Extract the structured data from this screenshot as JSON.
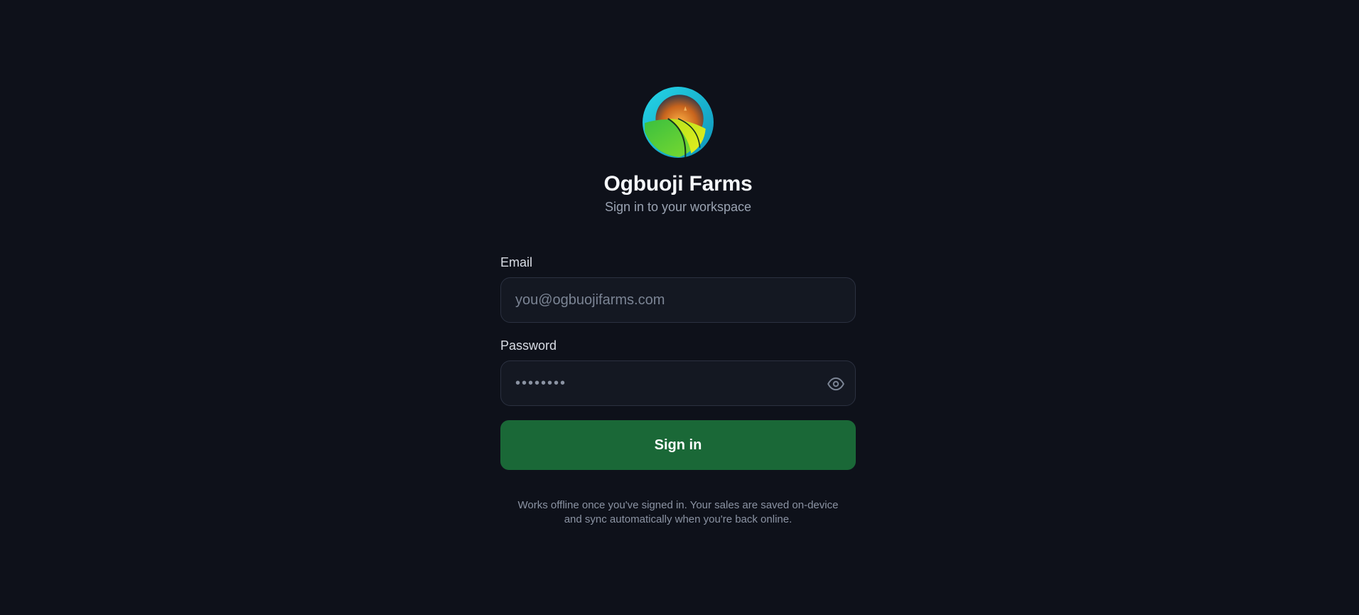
{
  "brand": {
    "name": "Ogbuoji Farms",
    "subtitle": "Sign in to your workspace",
    "logo_icon": "farm-sun-field-logo"
  },
  "form": {
    "email": {
      "label": "Email",
      "placeholder": "you@ogbuojifarms.com",
      "value": ""
    },
    "password": {
      "label": "Password",
      "placeholder": "••••••••",
      "value": "",
      "toggle_icon": "eye-icon"
    },
    "submit_label": "Sign in"
  },
  "footer": {
    "line1": "Works offline once you've signed in. Your sales are saved on-device",
    "line2": "and sync automatically when you're back online."
  },
  "colors": {
    "background": "#0e111a",
    "input_bg": "#141822",
    "input_border": "#2b3140",
    "button": "#1a6837",
    "logo_ring": "#19bfd8",
    "logo_field": "#5fcf3a",
    "logo_sun": "#f08a2a"
  }
}
